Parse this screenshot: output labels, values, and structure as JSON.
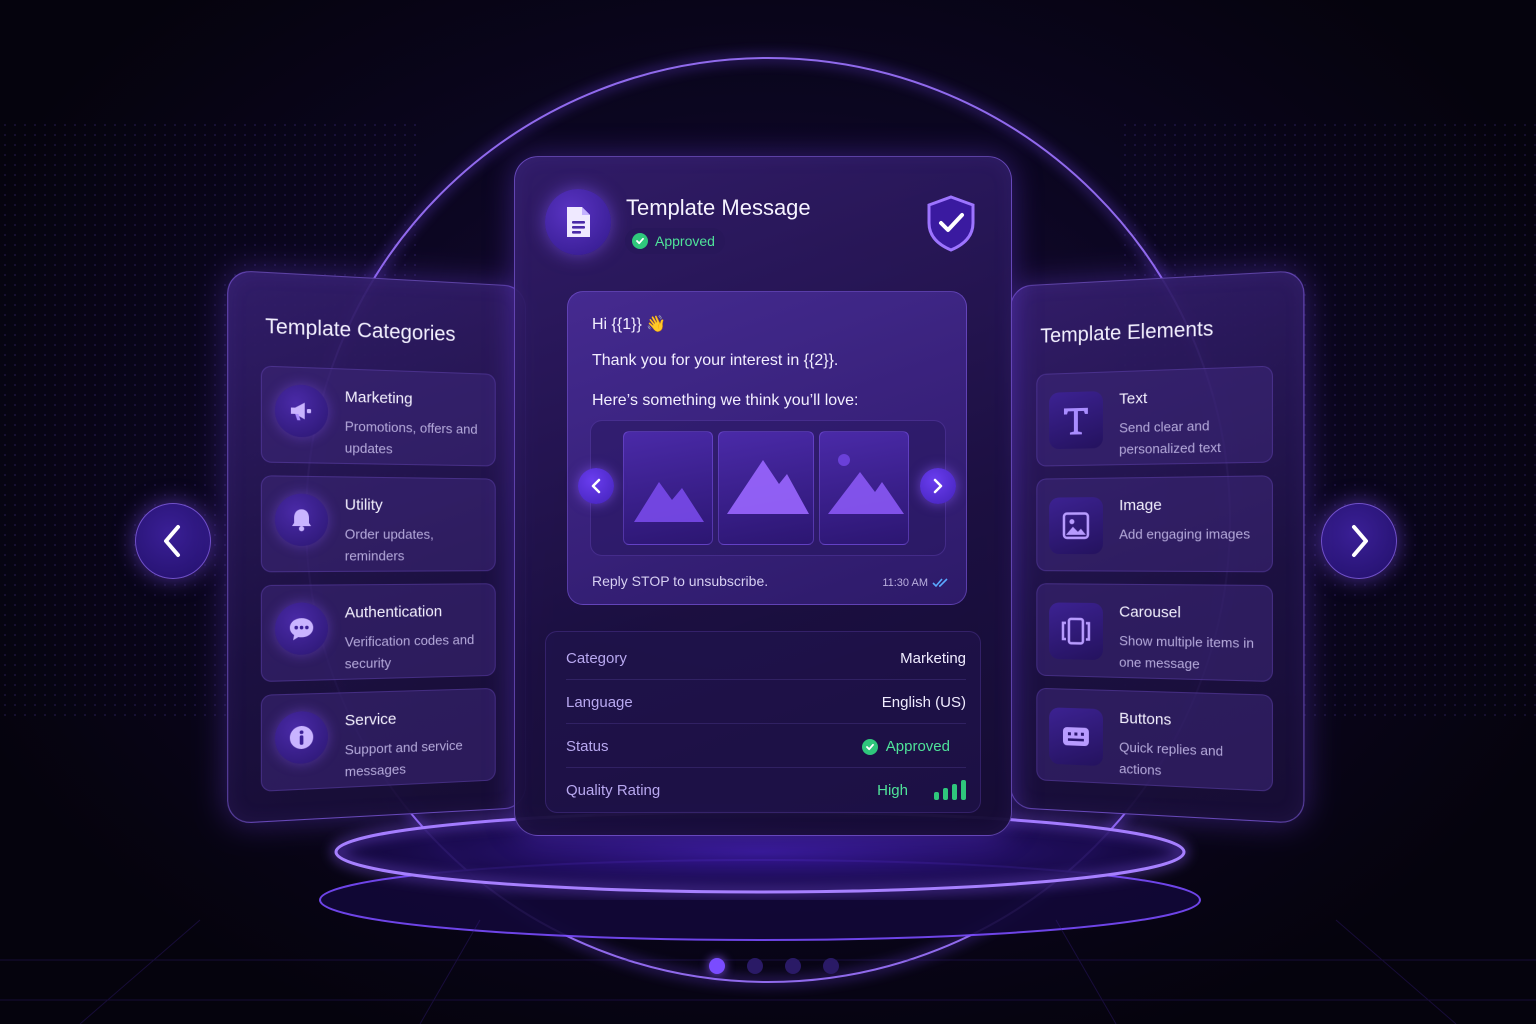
{
  "colors": {
    "accent": "#7a4cff",
    "approved": "#4fe39a",
    "background": "#0b0620"
  },
  "template_card": {
    "title": "Template Message",
    "status": "Approved",
    "icons": {
      "header": "document-icon",
      "shield": "shield-check-icon"
    },
    "message": {
      "greeting": "Hi {{1}} 👋",
      "line1": "Thank you for your interest in {{2}}.",
      "line2": "Here’s something we think you’ll love:",
      "footer": "Reply STOP to unsubscribe.",
      "time": "11:30 AM"
    },
    "details": [
      {
        "key": "Category",
        "value": "Marketing"
      },
      {
        "key": "Language",
        "value": "English (US)"
      },
      {
        "key": "Status",
        "value": "Approved"
      },
      {
        "key": "Quality Rating",
        "value": "High"
      }
    ]
  },
  "categories": {
    "title": "Template Categories",
    "items": [
      {
        "title": "Marketing",
        "desc": "Promotions, offers and updates",
        "icon": "megaphone-icon"
      },
      {
        "title": "Utility",
        "desc": "Order updates, reminders",
        "icon": "bell-icon"
      },
      {
        "title": "Authentication",
        "desc": "Verification codes and security",
        "icon": "chat-bubble-icon"
      },
      {
        "title": "Service",
        "desc": "Support and service messages",
        "icon": "info-icon"
      }
    ]
  },
  "elements": {
    "title": "Template Elements",
    "items": [
      {
        "title": "Text",
        "desc": "Send clear and personalized text",
        "icon": "text-icon"
      },
      {
        "title": "Image",
        "desc": "Add engaging images",
        "icon": "image-icon"
      },
      {
        "title": "Carousel",
        "desc": "Show multiple items in one message",
        "icon": "carousel-icon"
      },
      {
        "title": "Buttons",
        "desc": "Quick replies and actions",
        "icon": "buttons-icon"
      }
    ]
  },
  "pagination": {
    "total": 4,
    "active": 1
  }
}
